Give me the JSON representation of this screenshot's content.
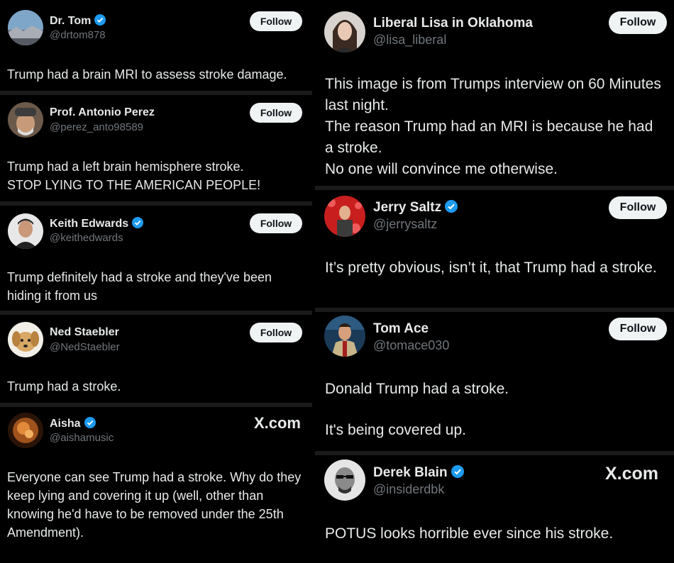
{
  "site_label": "X.com",
  "follow_label": "Follow",
  "verified_color": "#1d9bf0",
  "left_posts": [
    {
      "name": "Dr. Tom",
      "handle": "@drtom878",
      "verified": true,
      "lines": [
        "Trump had a brain MRI to assess stroke damage."
      ]
    },
    {
      "name": "Prof. Antonio Perez",
      "handle": "@perez_anto98589",
      "verified": false,
      "lines": [
        "Trump had a left brain hemisphere stroke.",
        "STOP LYING TO THE AMERICAN PEOPLE!"
      ]
    },
    {
      "name": "Keith Edwards",
      "handle": "@keithedwards",
      "verified": true,
      "lines": [
        "Trump definitely had a stroke and they've been hiding it from us"
      ]
    },
    {
      "name": "Ned Staebler",
      "handle": "@NedStaebler",
      "verified": false,
      "lines": [
        "Trump had a stroke."
      ]
    },
    {
      "name": "Aisha",
      "handle": "@aishamusic",
      "verified": true,
      "lines": [
        "Everyone can see Trump had a stroke. Why do they keep lying and covering it up (well, other than knowing he'd have to be removed under the 25th Amendment)."
      ]
    }
  ],
  "right_posts": [
    {
      "name": "Liberal Lisa in Oklahoma",
      "handle": "@lisa_liberal",
      "verified": false,
      "lines": [
        "This image is from Trumps interview on 60 Minutes last night.",
        "The reason Trump had an MRI is because he had a stroke.",
        "No one will convince me otherwise."
      ]
    },
    {
      "name": "Jerry Saltz",
      "handle": "@jerrysaltz",
      "verified": true,
      "lines": [
        "It’s pretty obvious, isn’t it, that Trump had a stroke."
      ]
    },
    {
      "name": "Tom Ace",
      "handle": "@tomace030",
      "verified": false,
      "lines": [
        "Donald Trump had a stroke.",
        "",
        "It's being covered up."
      ]
    },
    {
      "name": "Derek Blain",
      "handle": "@insiderdbk",
      "verified": true,
      "lines": [
        "POTUS looks horrible ever since his stroke."
      ]
    }
  ]
}
